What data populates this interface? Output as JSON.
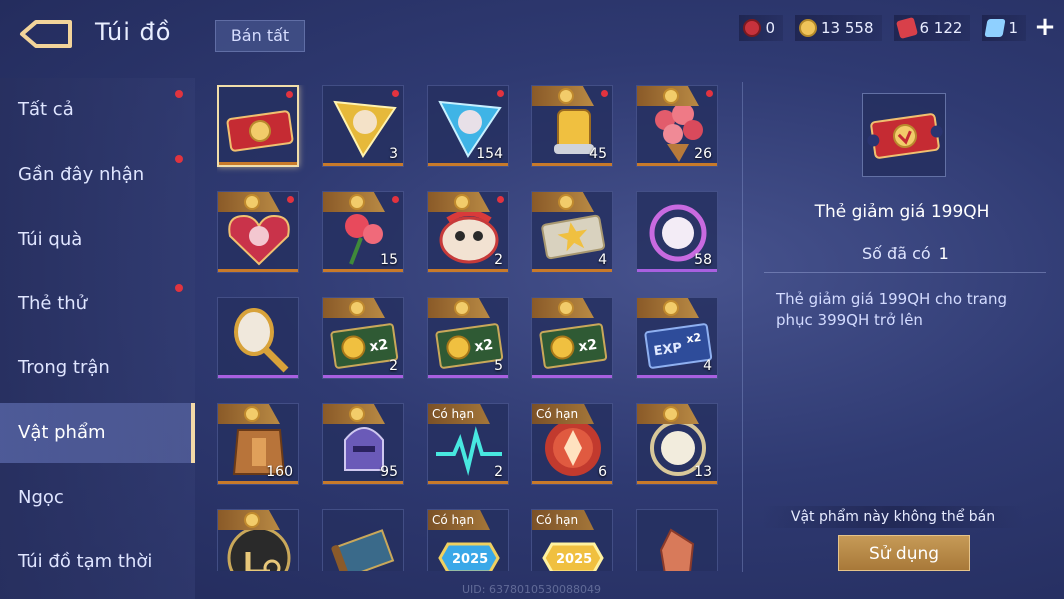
{
  "header": {
    "title": "Túi đồ",
    "sell_all_label": "Bán tất"
  },
  "currencies": [
    {
      "icon": "red-token-icon",
      "value": "0",
      "color": "#c7323c"
    },
    {
      "icon": "gold-coin-icon",
      "value": "13 558",
      "color": "#f0c45a"
    },
    {
      "icon": "red-voucher-icon",
      "value": "6 122",
      "color": "#d8404a"
    },
    {
      "icon": "blue-gem-icon",
      "value": "1",
      "color": "#8fd0ff"
    }
  ],
  "plus_label": "+",
  "sidebar": {
    "items": [
      {
        "label": "Tất cả",
        "dot": true
      },
      {
        "label": "Gần đây nhận",
        "dot": true
      },
      {
        "label": "Túi quà",
        "dot": false
      },
      {
        "label": "Thẻ thử",
        "dot": true
      },
      {
        "label": "Trong trận",
        "dot": false
      },
      {
        "label": "Vật phẩm",
        "dot": false,
        "active": true
      },
      {
        "label": "Ngọc",
        "dot": false
      },
      {
        "label": "Túi đồ tạm thời",
        "dot": false
      }
    ]
  },
  "items": [
    {
      "icon": "discount-ticket-icon",
      "qty": "",
      "tag": "",
      "dot": true
    },
    {
      "icon": "gold-skin-shard-icon",
      "qty": "3",
      "tag": "",
      "dot": true
    },
    {
      "icon": "blue-skin-shard-icon",
      "qty": "154",
      "tag": "",
      "dot": true
    },
    {
      "icon": "golden-scroll-icon",
      "qty": "45",
      "tag": "coin",
      "dot": true
    },
    {
      "icon": "rose-bouquet-icon",
      "qty": "26",
      "tag": "coin",
      "dot": true
    },
    {
      "icon": "heart-gift-box-icon",
      "qty": "",
      "tag": "coin",
      "dot": true
    },
    {
      "icon": "rose-icon",
      "qty": "15",
      "tag": "coin",
      "dot": true
    },
    {
      "icon": "lion-dance-icon",
      "qty": "2",
      "tag": "coin",
      "dot": true
    },
    {
      "icon": "star-ticket-icon",
      "qty": "4",
      "tag": "coin",
      "dot": false
    },
    {
      "icon": "purple-orb-icon",
      "qty": "58",
      "tag": "",
      "dot": false
    },
    {
      "icon": "golden-hammer-icon",
      "qty": "",
      "tag": "",
      "dot": false
    },
    {
      "icon": "gold-x2-card-icon",
      "qty": "2",
      "tag": "coin",
      "dot": false
    },
    {
      "icon": "gold-x2-card-icon",
      "qty": "5",
      "tag": "coin",
      "dot": false
    },
    {
      "icon": "gold-x2-card-icon",
      "qty": "",
      "tag": "coin",
      "dot": false
    },
    {
      "icon": "exp-x2-card-icon",
      "qty": "4",
      "tag": "coin",
      "dot": false
    },
    {
      "icon": "bronze-armor-icon",
      "qty": "160",
      "tag": "coin",
      "dot": false
    },
    {
      "icon": "purple-helmet-icon",
      "qty": "95",
      "tag": "coin",
      "dot": false
    },
    {
      "icon": "pulse-wave-icon",
      "qty": "2",
      "tag": "limited",
      "dot": false
    },
    {
      "icon": "red-crystal-orb-icon",
      "qty": "6",
      "tag": "limited",
      "dot": false
    },
    {
      "icon": "white-orb-icon",
      "qty": "13",
      "tag": "coin",
      "dot": false
    },
    {
      "icon": "hand-check-icon",
      "qty": "",
      "tag": "coin",
      "dot": false
    },
    {
      "icon": "map-scroll-icon",
      "qty": "",
      "tag": "",
      "dot": false
    },
    {
      "icon": "blue-2025-badge-icon",
      "qty": "",
      "tag": "limited",
      "dot": false
    },
    {
      "icon": "gold-2025-badge-icon",
      "qty": "",
      "tag": "limited",
      "dot": false
    },
    {
      "icon": "amber-crystal-icon",
      "qty": "",
      "tag": "",
      "dot": false
    }
  ],
  "limited_label": "Có hạn",
  "detail": {
    "name": "Thẻ giảm giá 199QH",
    "owned_label": "Số đã có",
    "owned_value": "1",
    "description": "Thẻ giảm giá 199QH cho trang phục 399QH trở lên",
    "cannot_sell": "Vật phẩm này không thể bán",
    "use_label": "Sử dụng"
  },
  "uid": "UID: 6378010530088049"
}
